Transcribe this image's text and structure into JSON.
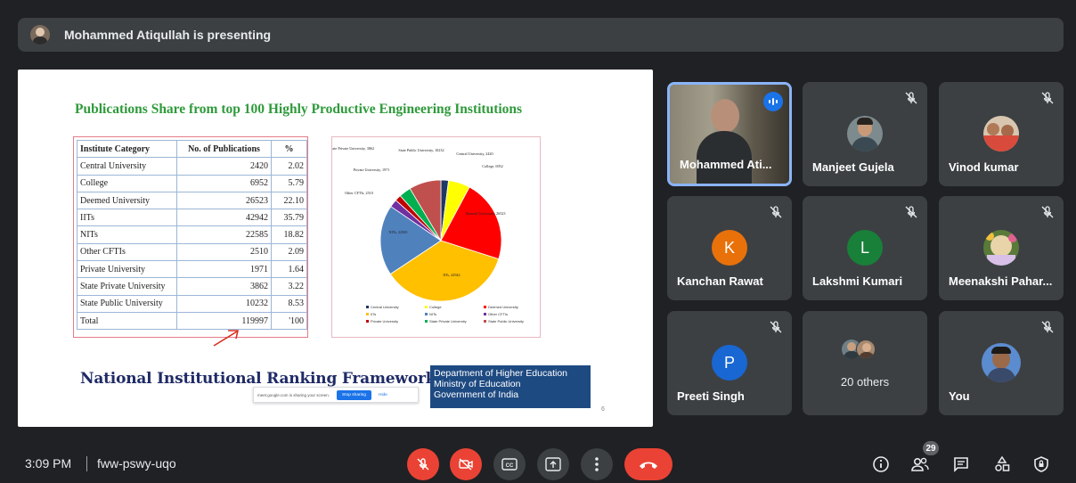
{
  "presenting": {
    "text": "Mohammed Atiqullah is presenting"
  },
  "slide": {
    "title": "Publications Share from top 100 Highly Productive Engineering Institutions",
    "table": {
      "headers": [
        "Institute Category",
        "No. of Publications",
        "%"
      ],
      "rows": [
        [
          "Central University",
          "2420",
          "2.02"
        ],
        [
          "College",
          "6952",
          "5.79"
        ],
        [
          "Deemed University",
          "26523",
          "22.10"
        ],
        [
          "IITs",
          "42942",
          "35.79"
        ],
        [
          "NITs",
          "22585",
          "18.82"
        ],
        [
          "Other CFTIs",
          "2510",
          "2.09"
        ],
        [
          "Private University",
          "1971",
          "1.64"
        ],
        [
          "State Private University",
          "3862",
          "3.22"
        ],
        [
          "State Public University",
          "10232",
          "8.53"
        ],
        [
          "Total",
          "119997",
          "'100"
        ]
      ]
    },
    "pie": {
      "labels": {
        "central": "Central University, 2420",
        "college": "College, 6952",
        "deemed": "Deemed University, 26523",
        "iits": "IITs, 42942",
        "nits": "NITs, 22585",
        "other": "Other CFTIs, 2510",
        "private": "Private University, 1971",
        "state_private": "State Private University, 3862",
        "state_public": "State Public University, 10232"
      },
      "legend": [
        "Central University",
        "College",
        "Deemed University",
        "IITs",
        "NITs",
        "Other CFTIs",
        "Private University",
        "State Private University",
        "State Public University"
      ],
      "colors": [
        "#1f3864",
        "#ffff00",
        "#ff0000",
        "#ffc000",
        "#4f81bd",
        "#7030a0",
        "#c00000",
        "#00b050",
        "#c0504d"
      ]
    },
    "nirf": "National Institutional Ranking Framework",
    "dept": [
      "Department of Higher Education",
      "Ministry of Education",
      "Government of India"
    ],
    "share_bar": {
      "text": "meet.google.com is sharing your screen.",
      "stop": "Stop sharing",
      "hide": "Hide"
    },
    "page_number": "6"
  },
  "participants": [
    {
      "name": "Mohammed Ati...",
      "speaking": true
    },
    {
      "name": "Manjeet Gujela",
      "muted": true
    },
    {
      "name": "Vinod kumar",
      "muted": true
    },
    {
      "name": "Kanchan Rawat",
      "initial": "K",
      "color": "#e8710a",
      "muted": true
    },
    {
      "name": "Lakshmi Kumari",
      "initial": "L",
      "color": "#188038",
      "muted": true
    },
    {
      "name": "Meenakshi Pahar...",
      "muted": true
    },
    {
      "name": "Preeti Singh",
      "initial": "P",
      "color": "#1967d2",
      "muted": true
    },
    {
      "name": "20 others"
    },
    {
      "name": "You",
      "muted": true
    }
  ],
  "bottom": {
    "time": "3:09 PM",
    "meeting_code": "fww-pswy-uqo",
    "people_count": "29"
  },
  "icons": [
    "mic-off-icon",
    "camera-off-icon",
    "captions-icon",
    "present-icon",
    "more-icon",
    "end-call-icon",
    "info-icon",
    "people-icon",
    "chat-icon",
    "activities-icon",
    "host-controls-icon"
  ]
}
